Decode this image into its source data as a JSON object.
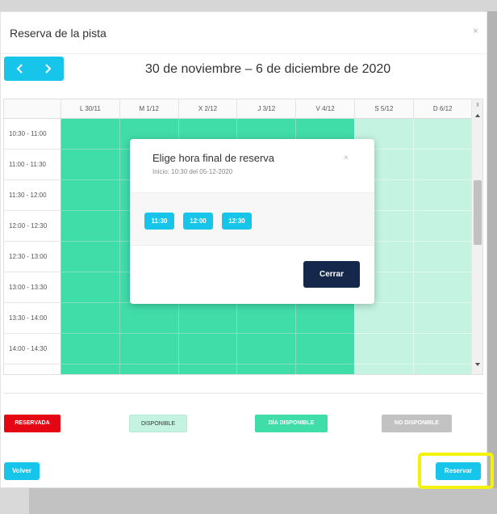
{
  "modal": {
    "title": "Reserva de la pista",
    "close_glyph": "×"
  },
  "week": {
    "title": "30 de noviembre – 6 de diciembre de 2020",
    "prev_icon": "chevron-left-icon",
    "next_icon": "chevron-right-icon"
  },
  "calendar": {
    "days": [
      "L 30/11",
      "M 1/12",
      "X 2/12",
      "J 3/12",
      "V 4/12",
      "S 5/12",
      "D 6/12"
    ],
    "times": [
      "10:30 - 11:00",
      "11:00 - 11:30",
      "11:30 - 12:00",
      "12:00 - 12:30",
      "12:30 - 13:00",
      "13:00 - 13:30",
      "13:30 - 14:00",
      "14:00 - 14:30"
    ],
    "day_status": [
      "disponible",
      "disponible",
      "disponible",
      "disponible",
      "disponible",
      "día disponible",
      "día disponible"
    ]
  },
  "legend": {
    "reserved": "RESERVADA",
    "available": "DISPONIBLE",
    "day_available": "DÍA DISPONIBLE",
    "unavailable": "NO DISPONIBLE"
  },
  "footer": {
    "back": "Volver",
    "reserve": "Reservar"
  },
  "popup": {
    "title": "Elige hora final de reserva",
    "subtitle": "Inicio: 10:30 del 05-12-2020",
    "close_glyph": "×",
    "times": [
      "11:30",
      "12:00",
      "12:30"
    ],
    "close_button": "Cerrar"
  },
  "colors": {
    "accent": "#17c5eb",
    "slot_green": "#40dda9",
    "slot_light": "#c4f4e1",
    "reserved_red": "#e40613",
    "unavailable_gray": "#c2c2c2",
    "dark_navy": "#15284b",
    "highlight_yellow": "#f4f20c"
  }
}
